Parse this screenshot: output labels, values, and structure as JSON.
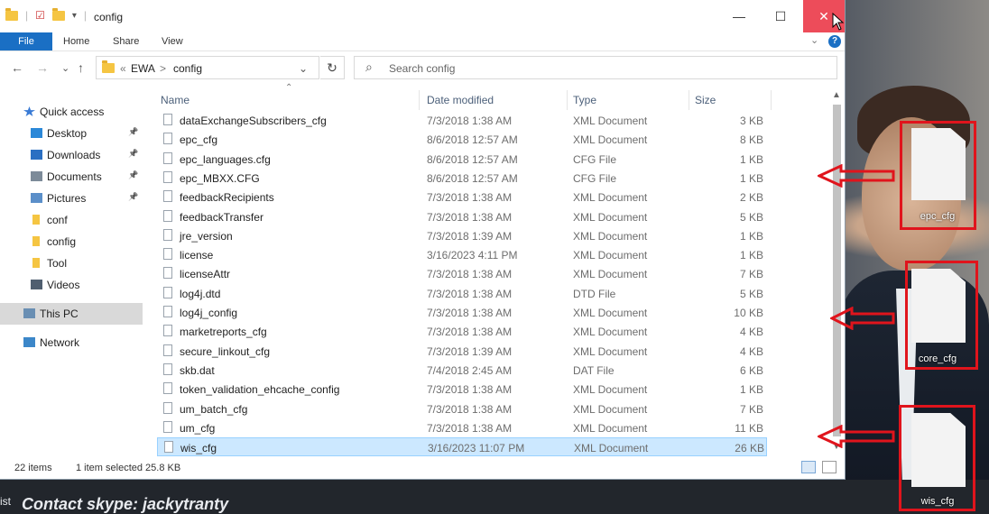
{
  "window": {
    "title": "config",
    "minimize": "—",
    "maximize": "☐",
    "close": "✕"
  },
  "ribbon": {
    "tabs": [
      "File",
      "Home",
      "Share",
      "View"
    ],
    "help": "?"
  },
  "navbar": {
    "back": "←",
    "forward": "→",
    "recent": "⌄",
    "up": "↑",
    "path": [
      "«",
      "EWA",
      ">",
      "config"
    ],
    "refresh": "↻",
    "search_placeholder": "Search config"
  },
  "nav_pane": [
    {
      "label": "Quick access",
      "icon": "star-icon",
      "pinned": false
    },
    {
      "label": "Desktop",
      "icon": "desktop-icon",
      "pinned": true
    },
    {
      "label": "Downloads",
      "icon": "download-icon",
      "pinned": true
    },
    {
      "label": "Documents",
      "icon": "documents-icon",
      "pinned": true
    },
    {
      "label": "Pictures",
      "icon": "pictures-icon",
      "pinned": true
    },
    {
      "label": "conf",
      "icon": "folder-icon",
      "pinned": false
    },
    {
      "label": "config",
      "icon": "folder-icon",
      "pinned": false
    },
    {
      "label": "Tool",
      "icon": "folder-icon",
      "pinned": false
    },
    {
      "label": "Videos",
      "icon": "videos-icon",
      "pinned": false
    },
    {
      "label": "This PC",
      "icon": "computer-icon",
      "pinned": false,
      "selected": true
    },
    {
      "label": "Network",
      "icon": "network-icon",
      "pinned": false
    }
  ],
  "columns": [
    "Name",
    "Date modified",
    "Type",
    "Size"
  ],
  "files": [
    {
      "name": "dataExchangeSubscribers_cfg",
      "date": "7/3/2018 1:38 AM",
      "type": "XML Document",
      "size": "3 KB"
    },
    {
      "name": "epc_cfg",
      "date": "8/6/2018 12:57 AM",
      "type": "XML Document",
      "size": "8 KB"
    },
    {
      "name": "epc_languages.cfg",
      "date": "8/6/2018 12:57 AM",
      "type": "CFG File",
      "size": "1 KB"
    },
    {
      "name": "epc_MBXX.CFG",
      "date": "8/6/2018 12:57 AM",
      "type": "CFG File",
      "size": "1 KB"
    },
    {
      "name": "feedbackRecipients",
      "date": "7/3/2018 1:38 AM",
      "type": "XML Document",
      "size": "2 KB"
    },
    {
      "name": "feedbackTransfer",
      "date": "7/3/2018 1:38 AM",
      "type": "XML Document",
      "size": "5 KB"
    },
    {
      "name": "jre_version",
      "date": "7/3/2018 1:39 AM",
      "type": "XML Document",
      "size": "1 KB"
    },
    {
      "name": "license",
      "date": "3/16/2023 4:11 PM",
      "type": "XML Document",
      "size": "1 KB"
    },
    {
      "name": "licenseAttr",
      "date": "7/3/2018 1:38 AM",
      "type": "XML Document",
      "size": "7 KB"
    },
    {
      "name": "log4j.dtd",
      "date": "7/3/2018 1:38 AM",
      "type": "DTD File",
      "size": "5 KB"
    },
    {
      "name": "log4j_config",
      "date": "7/3/2018 1:38 AM",
      "type": "XML Document",
      "size": "10 KB"
    },
    {
      "name": "marketreports_cfg",
      "date": "7/3/2018 1:38 AM",
      "type": "XML Document",
      "size": "4 KB"
    },
    {
      "name": "secure_linkout_cfg",
      "date": "7/3/2018 1:39 AM",
      "type": "XML Document",
      "size": "4 KB"
    },
    {
      "name": "skb.dat",
      "date": "7/4/2018 2:45 AM",
      "type": "DAT File",
      "size": "6 KB"
    },
    {
      "name": "token_validation_ehcache_config",
      "date": "7/3/2018 1:38 AM",
      "type": "XML Document",
      "size": "1 KB"
    },
    {
      "name": "um_batch_cfg",
      "date": "7/3/2018 1:38 AM",
      "type": "XML Document",
      "size": "7 KB"
    },
    {
      "name": "um_cfg",
      "date": "7/3/2018 1:38 AM",
      "type": "XML Document",
      "size": "11 KB"
    },
    {
      "name": "wis_cfg",
      "date": "3/16/2023 11:07 PM",
      "type": "XML Document",
      "size": "26 KB",
      "selected": true
    }
  ],
  "status": {
    "items": "22 items",
    "selected": "1 item selected  25.8 KB"
  },
  "desktop_files": [
    "epc_cfg",
    "core_cfg",
    "wis_cfg"
  ],
  "overlay": {
    "bottom_text": "Contact skype: jackytranty",
    "left_fragment": "ist"
  },
  "colors": {
    "file_tab": "#1a6fc4",
    "selection": "#cce8ff",
    "annotation_red": "#e0141c"
  }
}
